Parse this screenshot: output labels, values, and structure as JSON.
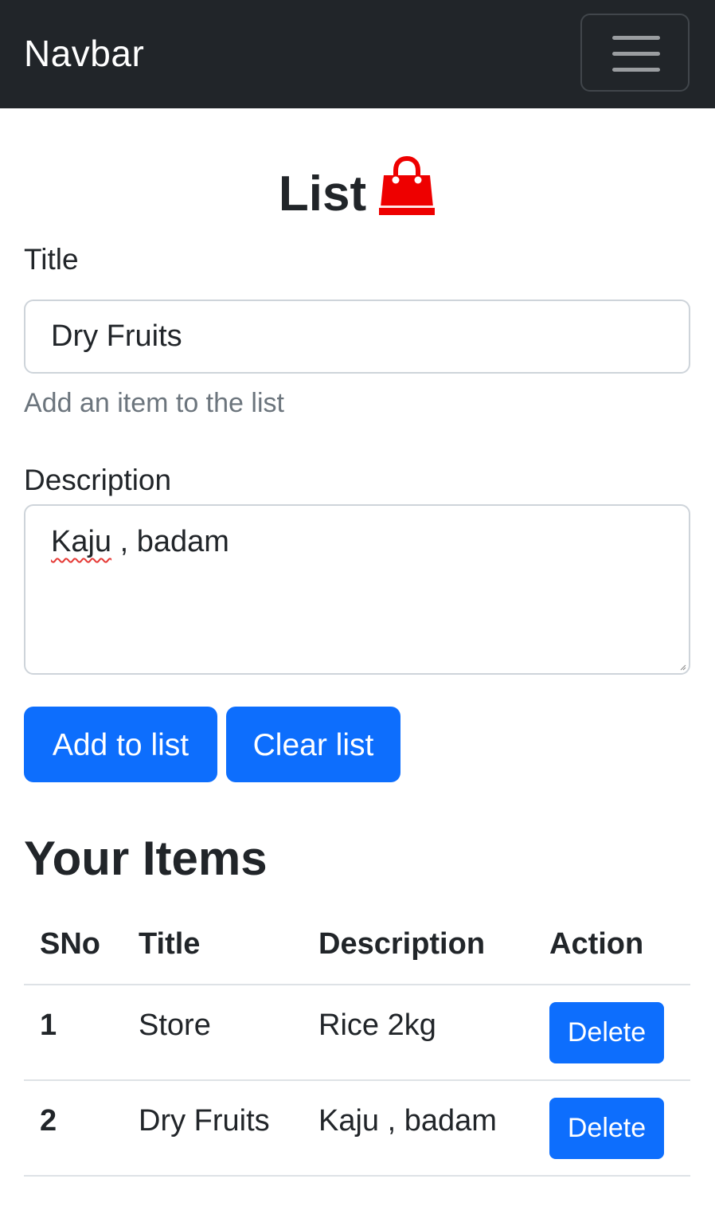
{
  "navbar": {
    "brand": "Navbar",
    "toggler_icon": "hamburger-menu-icon"
  },
  "main": {
    "heading": "List",
    "heading_icon": "shopping-bag-icon",
    "heading_icon_color": "#ee0000",
    "title_label": "Title",
    "title_value": "Dry Fruits",
    "title_help": "Add an item to the list",
    "description_label": "Description",
    "description_value_word1": "Kaju",
    "description_value_rest": " , badam",
    "add_button": "Add to list",
    "clear_button": "Clear list"
  },
  "items": {
    "heading": "Your Items",
    "columns": [
      "SNo",
      "Title",
      "Description",
      "Action"
    ],
    "rows": [
      {
        "sno": "1",
        "title": "Store",
        "description": "Rice 2kg",
        "action": "Delete"
      },
      {
        "sno": "2",
        "title": "Dry Fruits",
        "description": "Kaju , badam",
        "action": "Delete"
      }
    ]
  },
  "colors": {
    "navbar_bg": "#212529",
    "primary": "#0d6efd",
    "muted_text": "#6c757d"
  }
}
